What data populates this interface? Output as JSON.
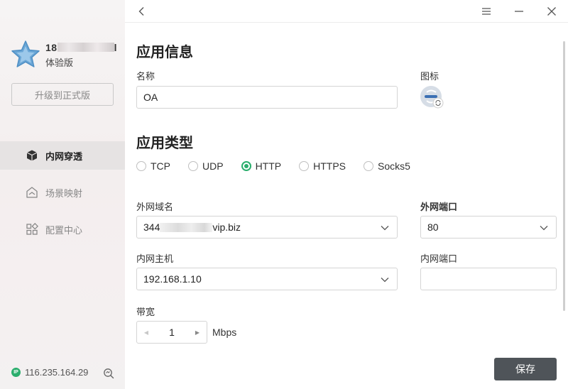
{
  "sidebar": {
    "user": {
      "name_prefix": "18",
      "name_suffix": "l",
      "plan": "体验版"
    },
    "upgrade_label": "升级到正式版",
    "items": [
      {
        "label": "内网穿透",
        "icon": "cube-icon",
        "active": true
      },
      {
        "label": "场景映射",
        "icon": "scene-map-icon",
        "active": false
      },
      {
        "label": "配置中心",
        "icon": "grid-config-icon",
        "active": false
      }
    ],
    "ip": {
      "badge": "IP",
      "address": "116.235.164.29"
    }
  },
  "main": {
    "app_info": {
      "title": "应用信息",
      "name_label": "名称",
      "name_value": "OA",
      "icon_label": "图标"
    },
    "app_type": {
      "title": "应用类型",
      "options": [
        "TCP",
        "UDP",
        "HTTP",
        "HTTPS",
        "Socks5"
      ],
      "selected": "HTTP"
    },
    "external_domain": {
      "label": "外网域名",
      "value_prefix": "344",
      "value_suffix": "vip.biz"
    },
    "external_port": {
      "label": "外网端口",
      "value": "80"
    },
    "internal_host": {
      "label": "内网主机",
      "value": "192.168.1.10"
    },
    "internal_port": {
      "label": "内网端口",
      "value": ""
    },
    "bandwidth": {
      "label": "带宽",
      "value": "1",
      "unit": "Mbps"
    },
    "save_label": "保存"
  },
  "colors": {
    "accent": "#2bae6d",
    "save_button": "#4f5459",
    "sidebar_active": "#e6e3e3"
  }
}
